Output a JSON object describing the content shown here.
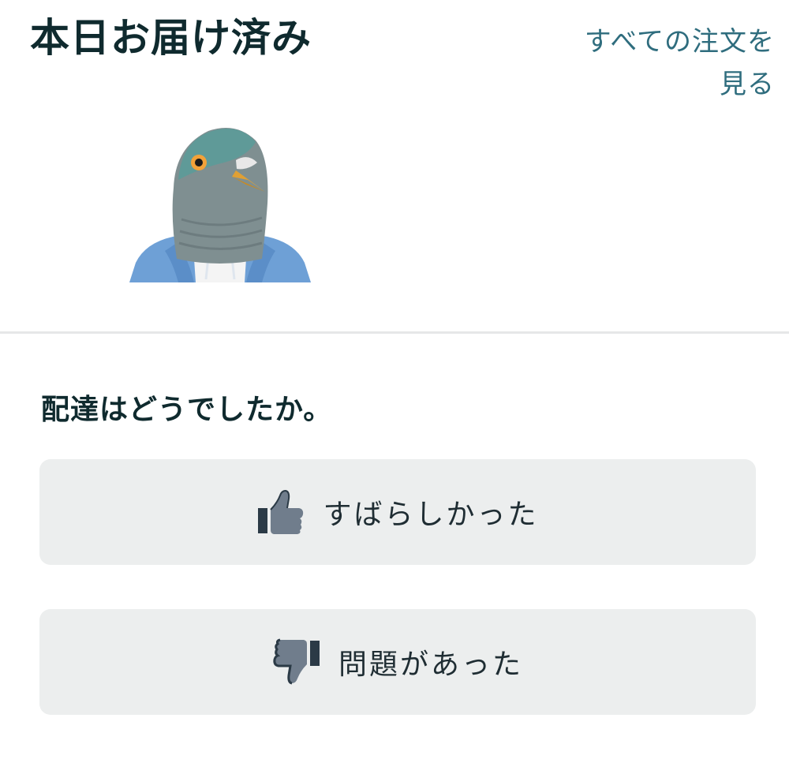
{
  "header": {
    "title": "本日お届け済み",
    "view_all_orders_line1": "すべての注文を",
    "view_all_orders_line2": "見る"
  },
  "product": {
    "image_icon": "pigeon-mask-product-image"
  },
  "feedback": {
    "question": "配達はどうでしたか。",
    "good_label": "すばらしかった",
    "good_icon": "thumbs-up-icon",
    "bad_label": "問題があった",
    "bad_icon": "thumbs-down-icon"
  },
  "colors": {
    "title": "#0f2a2e",
    "link": "#2f6d7e",
    "button_bg": "#eceeee",
    "divider": "#e6e7e8"
  }
}
